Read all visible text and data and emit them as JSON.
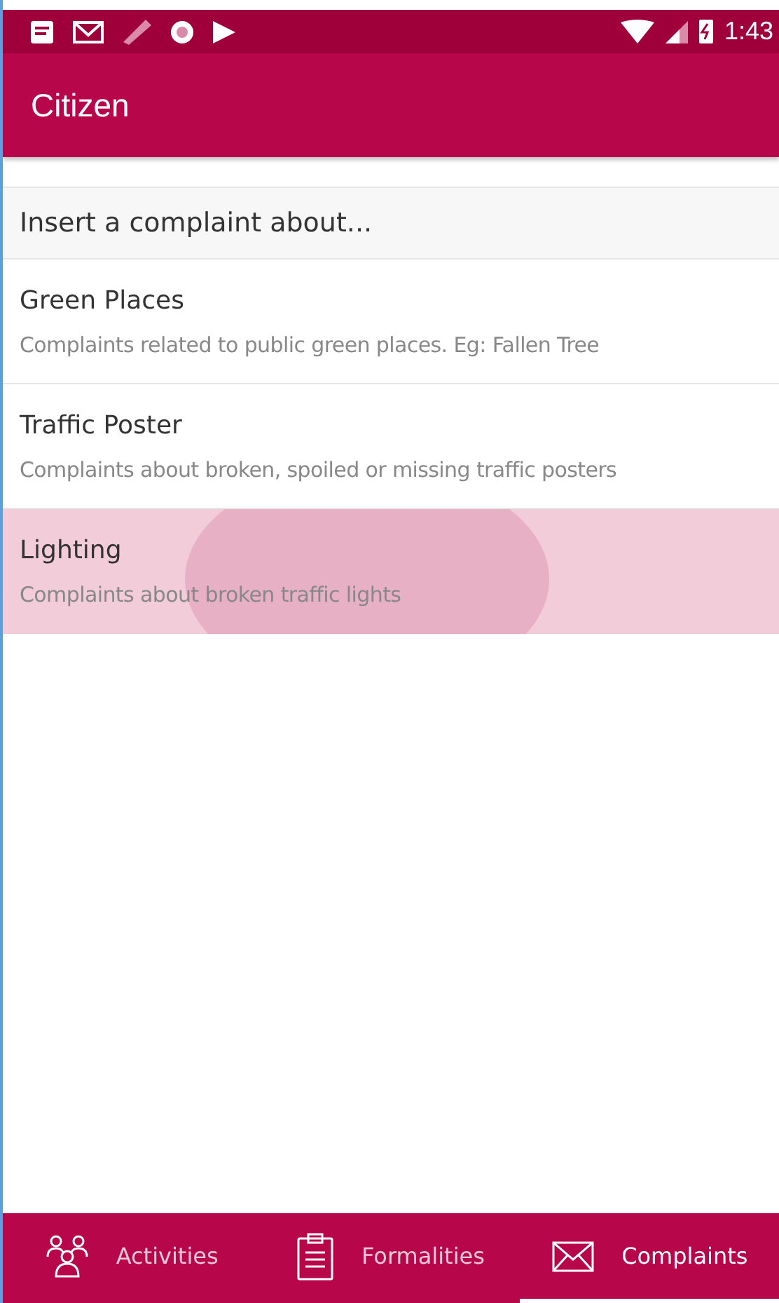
{
  "status_bar": {
    "time": "1:43"
  },
  "app_bar": {
    "title": "Citizen"
  },
  "section_header": "Insert a complaint about...",
  "complaints": [
    {
      "title": "Green Places",
      "description": "Complaints related to public green places. Eg: Fallen Tree",
      "selected": false
    },
    {
      "title": "Traffic Poster",
      "description": "Complaints about broken, spoiled or missing traffic posters",
      "selected": false
    },
    {
      "title": "Lighting",
      "description": "Complaints about broken traffic lights",
      "selected": true
    }
  ],
  "bottom_nav": [
    {
      "kind": "people",
      "label": "Activities",
      "selected": false
    },
    {
      "kind": "clipboard",
      "label": "Formalities",
      "selected": false
    },
    {
      "kind": "mail",
      "label": "Complaints",
      "selected": true
    }
  ]
}
